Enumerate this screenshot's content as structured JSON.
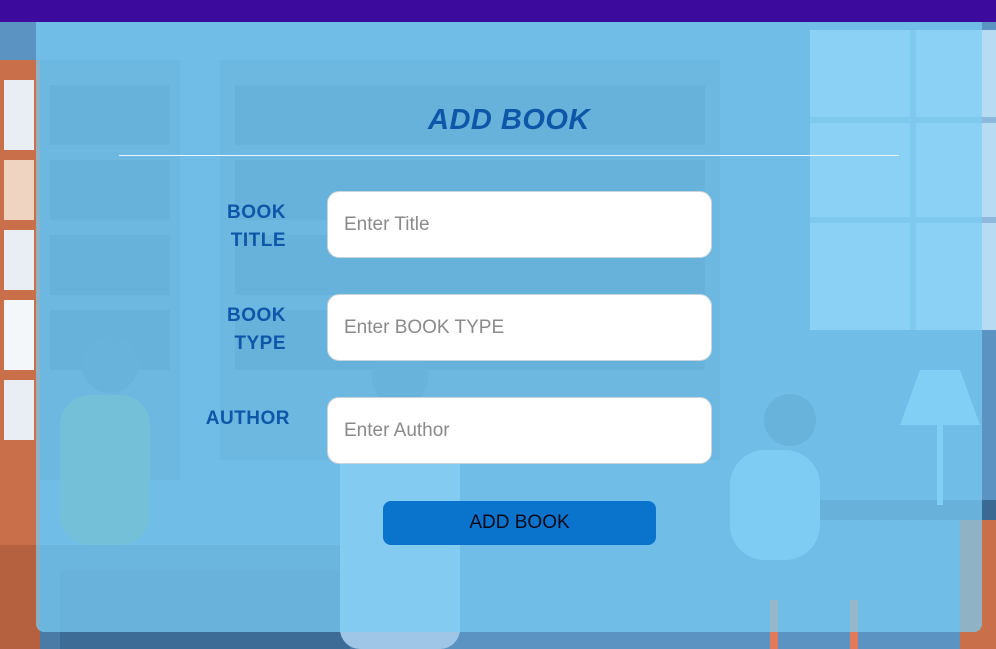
{
  "form": {
    "heading": "ADD BOOK",
    "fields": [
      {
        "label_line1": "BOOK",
        "label_line2": "TITLE",
        "placeholder": "Enter Title",
        "value": ""
      },
      {
        "label_line1": "BOOK",
        "label_line2": "TYPE",
        "placeholder": "Enter BOOK TYPE",
        "value": ""
      },
      {
        "label_line1": "AUTHOR",
        "label_line2": "",
        "placeholder": "Enter Author",
        "value": ""
      }
    ],
    "submit_label": "ADD BOOK"
  },
  "colors": {
    "header_bar": "#3d0a9e",
    "panel": "#78cdf5",
    "label_text": "#0e56a8",
    "button": "#0a74cc"
  }
}
